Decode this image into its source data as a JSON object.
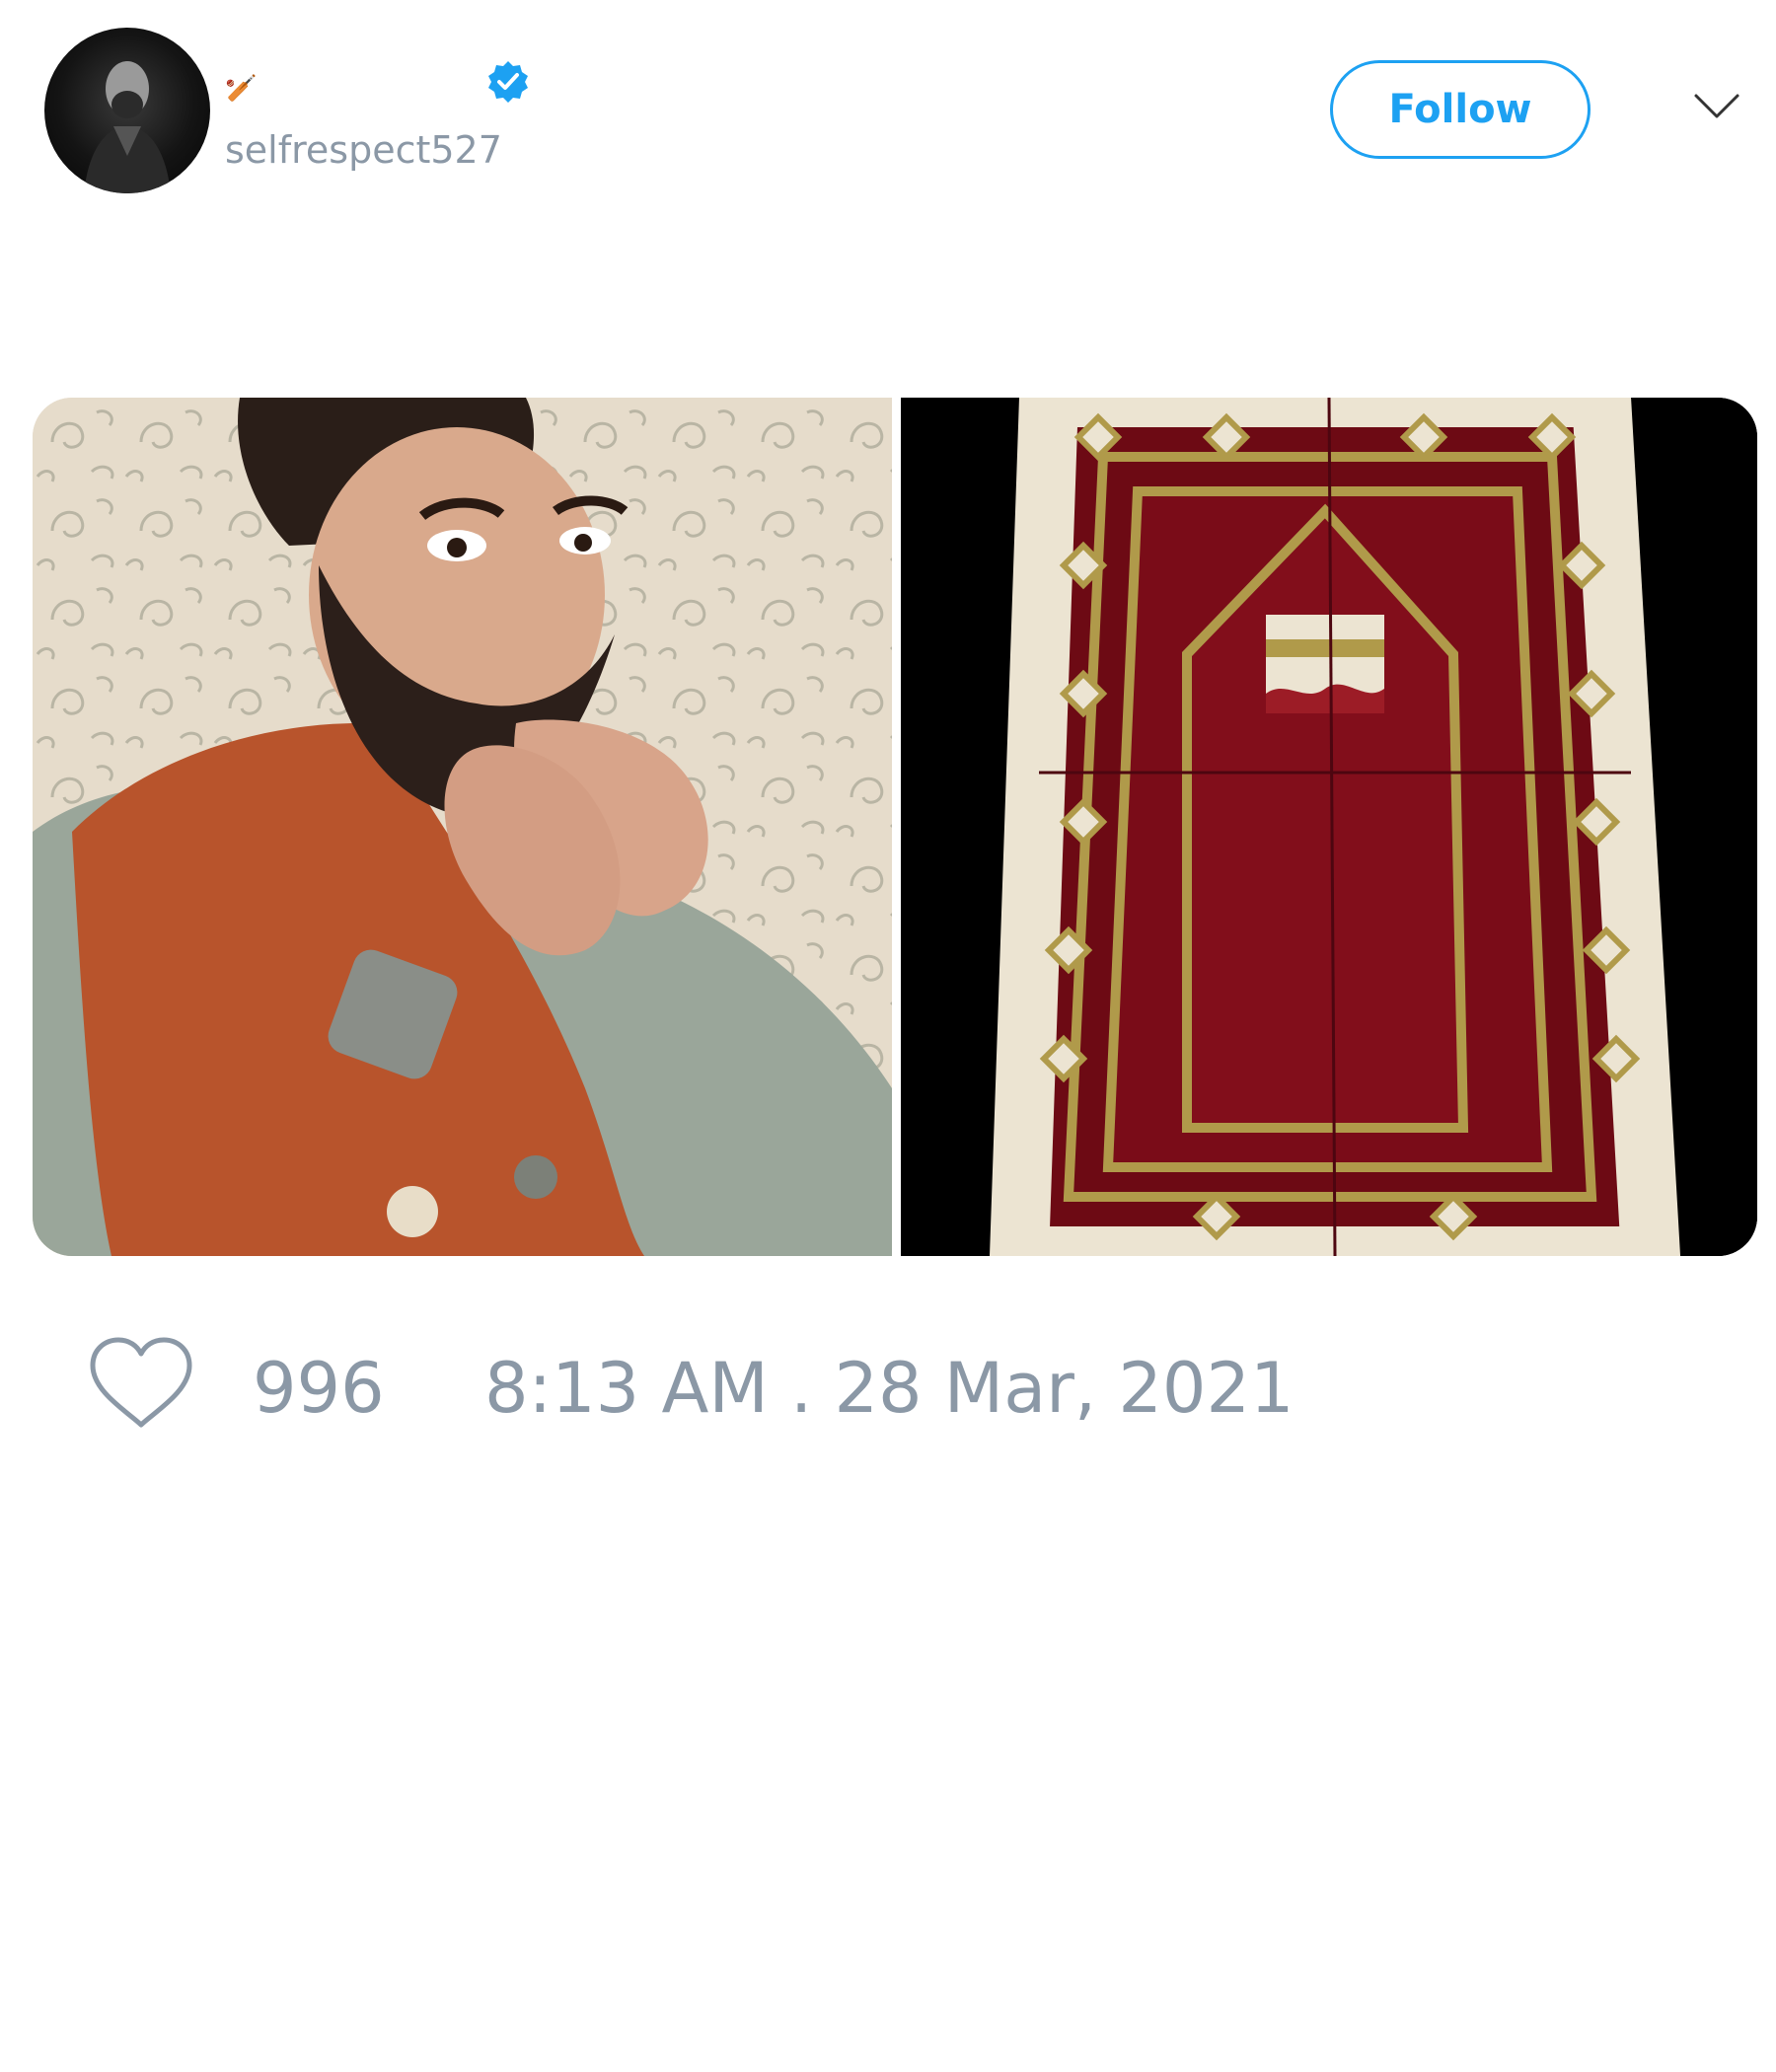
{
  "tweet": {
    "author": {
      "display_name_emoji": "🏏",
      "handle": "selfrespect527",
      "verified": true
    },
    "follow_label": "Follow",
    "media": [
      {
        "kind": "photo",
        "subject": "man-in-waistcoat"
      },
      {
        "kind": "photo",
        "subject": "prayer-rug"
      }
    ],
    "likes": "996",
    "timestamp": "8:13 AM . 28 Mar, 2021"
  },
  "colors": {
    "accent": "#1da1f2",
    "muted_text": "#8b98a6"
  },
  "icons": {
    "verified": "verified-badge-icon",
    "menu": "chevron-down-icon",
    "like": "heart-icon"
  }
}
